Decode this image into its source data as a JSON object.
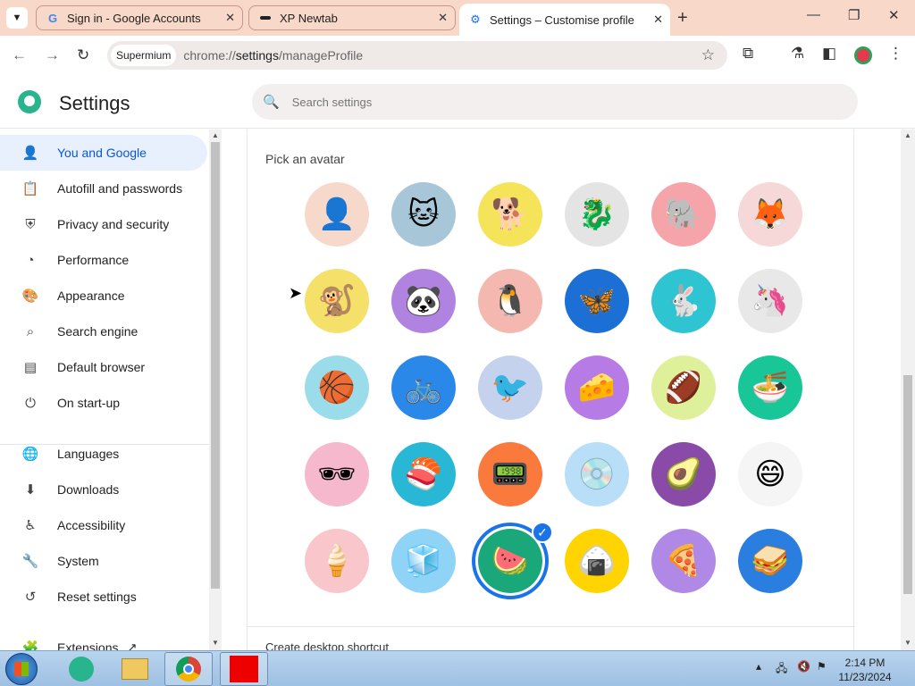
{
  "browser": {
    "tabs": [
      {
        "title": "Sign in - Google Accounts",
        "favicon": "google-g-icon"
      },
      {
        "title": "XP Newtab",
        "favicon": "dash-icon"
      },
      {
        "title": "Settings – Customise profile",
        "favicon": "settings-gear-icon"
      }
    ],
    "active_tab": 2,
    "omnibox": {
      "chip": "Supermium",
      "url_prefix": "chrome://",
      "url_host": "settings",
      "url_path": "/manageProfile"
    }
  },
  "settings": {
    "title": "Settings",
    "search_placeholder": "Search settings",
    "nav": [
      {
        "label": "You and Google",
        "icon": "person-icon",
        "active": true
      },
      {
        "label": "Autofill and passwords",
        "icon": "clipboard-icon"
      },
      {
        "label": "Privacy and security",
        "icon": "shield-icon"
      },
      {
        "label": "Performance",
        "icon": "speedometer-icon"
      },
      {
        "label": "Appearance",
        "icon": "palette-icon"
      },
      {
        "label": "Search engine",
        "icon": "search-icon"
      },
      {
        "label": "Default browser",
        "icon": "browser-window-icon"
      },
      {
        "label": "On start-up",
        "icon": "power-icon"
      },
      {
        "label": "Languages",
        "icon": "globe-icon"
      },
      {
        "label": "Downloads",
        "icon": "download-icon"
      },
      {
        "label": "Accessibility",
        "icon": "accessibility-icon"
      },
      {
        "label": "System",
        "icon": "wrench-icon"
      },
      {
        "label": "Reset settings",
        "icon": "history-icon"
      },
      {
        "label": "Extensions",
        "icon": "puzzle-icon"
      }
    ]
  },
  "profile": {
    "pick_avatar_label": "Pick an avatar",
    "selected_avatar": 26,
    "avatars": [
      {
        "name": "generic-person",
        "bg": "#f7d9cc",
        "glyph": "👤"
      },
      {
        "name": "cat",
        "bg": "#a7c7d8",
        "glyph": "🐱"
      },
      {
        "name": "corgi",
        "bg": "#f5e45a",
        "glyph": "🐕"
      },
      {
        "name": "dragon",
        "bg": "#e4e4e4",
        "glyph": "🐉"
      },
      {
        "name": "elephant",
        "bg": "#f5a5aa",
        "glyph": "🐘"
      },
      {
        "name": "fox",
        "bg": "#f6d8d8",
        "glyph": "🦊"
      },
      {
        "name": "monkey",
        "bg": "#f5e06a",
        "glyph": "🐒"
      },
      {
        "name": "panda",
        "bg": "#b183e0",
        "glyph": "🐼"
      },
      {
        "name": "penguin",
        "bg": "#f4b8b0",
        "glyph": "🐧"
      },
      {
        "name": "butterfly",
        "bg": "#1c6fd4",
        "glyph": "🦋"
      },
      {
        "name": "rabbit",
        "bg": "#2fc4d2",
        "glyph": "🐇"
      },
      {
        "name": "unicorn",
        "bg": "#e8e8e8",
        "glyph": "🦄"
      },
      {
        "name": "basketball",
        "bg": "#9bdcea",
        "glyph": "🏀"
      },
      {
        "name": "bike",
        "bg": "#2a88e8",
        "glyph": "🚲"
      },
      {
        "name": "bird",
        "bg": "#c5d2ee",
        "glyph": "🐦"
      },
      {
        "name": "cheese",
        "bg": "#b67be4",
        "glyph": "🧀"
      },
      {
        "name": "football",
        "bg": "#dff09a",
        "glyph": "🏈"
      },
      {
        "name": "ramen",
        "bg": "#18c698",
        "glyph": "🍜"
      },
      {
        "name": "sunglasses",
        "bg": "#f5b8cc",
        "glyph": "🕶"
      },
      {
        "name": "sushi",
        "bg": "#28b8d6",
        "glyph": "🍣"
      },
      {
        "name": "tamagotchi",
        "bg": "#fa7a3e",
        "glyph": "📟"
      },
      {
        "name": "vinyl",
        "bg": "#b8def8",
        "glyph": "💿"
      },
      {
        "name": "avocado",
        "bg": "#8a4aa8",
        "glyph": "🥑"
      },
      {
        "name": "smiley",
        "bg": "#f5f5f5",
        "glyph": "😄"
      },
      {
        "name": "ice-cream",
        "bg": "#f9c6cc",
        "glyph": "🍦"
      },
      {
        "name": "ice-cube",
        "bg": "#8fd4f6",
        "glyph": "🧊"
      },
      {
        "name": "watermelon",
        "bg": "#1aa87a",
        "glyph": "🍉"
      },
      {
        "name": "onigiri",
        "bg": "#ffd400",
        "glyph": "🍙"
      },
      {
        "name": "pizza",
        "bg": "#b088e6",
        "glyph": "🍕"
      },
      {
        "name": "sandwich",
        "bg": "#2a7ee0",
        "glyph": "🥪"
      }
    ],
    "desktop_shortcut_label": "Create desktop shortcut"
  },
  "taskbar": {
    "clock_time": "2:14 PM",
    "clock_date": "11/23/2024"
  }
}
